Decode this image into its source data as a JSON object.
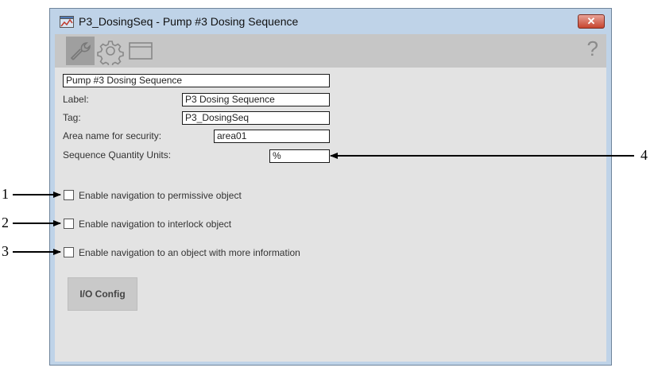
{
  "window": {
    "title": "P3_DosingSeq - Pump #3 Dosing Sequence",
    "close_label": "✕"
  },
  "toolbar": {
    "items": [
      {
        "icon": "wrench-icon",
        "selected": true
      },
      {
        "icon": "gear-icon",
        "selected": false
      },
      {
        "icon": "window-icon",
        "selected": false
      }
    ],
    "help_label": "?"
  },
  "form": {
    "description": "Pump #3 Dosing Sequence",
    "label_caption": "Label:",
    "label_value": "P3 Dosing Sequence",
    "tag_caption": "Tag:",
    "tag_value": "P3_DosingSeq",
    "area_caption": "Area name for security:",
    "area_value": "area01",
    "units_caption": "Sequence Quantity Units:",
    "units_value": "%"
  },
  "options": [
    {
      "label": "Enable navigation to permissive object",
      "checked": false
    },
    {
      "label": "Enable navigation to interlock object",
      "checked": false
    },
    {
      "label": "Enable navigation to an object with more information",
      "checked": false
    }
  ],
  "io_config_label": "I/O Config",
  "callouts": [
    "1",
    "2",
    "3",
    "4"
  ]
}
